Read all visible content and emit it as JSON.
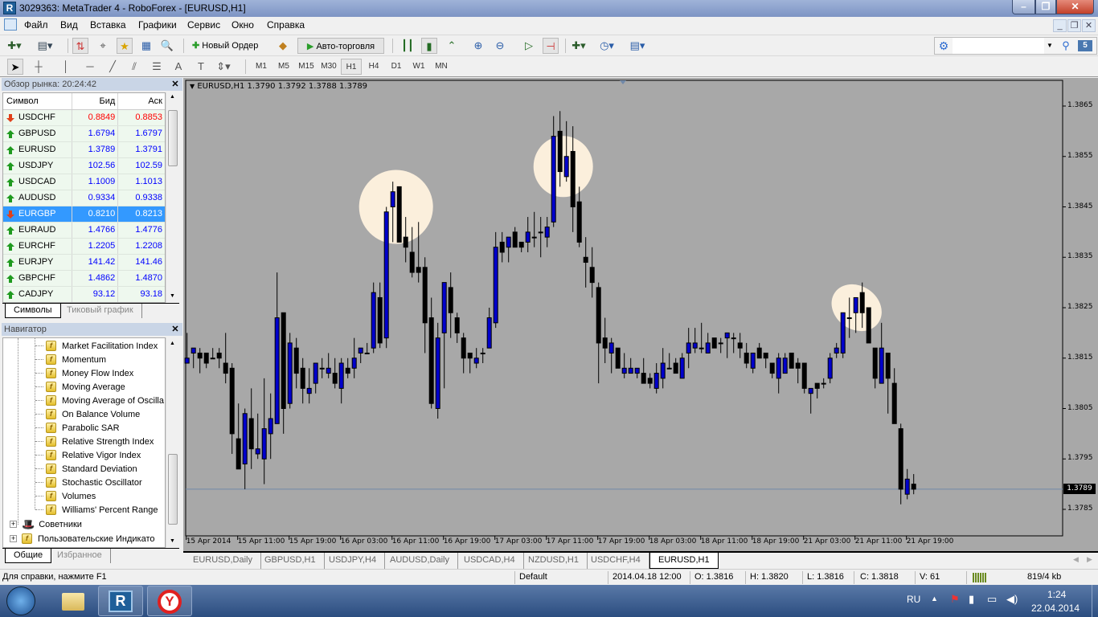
{
  "window": {
    "title": "3029363: MetaTrader 4 - RoboForex - [EURUSD,H1]",
    "logo_text": "R"
  },
  "menu": [
    "Файл",
    "Вид",
    "Вставка",
    "Графики",
    "Сервис",
    "Окно",
    "Справка"
  ],
  "toolbar": {
    "new_order": "Новый Ордер",
    "autotrading": "Авто-торговля",
    "timeframes": [
      "M1",
      "M5",
      "M15",
      "M30",
      "H1",
      "H4",
      "D1",
      "W1",
      "MN"
    ],
    "active_timeframe": "H1",
    "text_tool": "A",
    "search_value": "",
    "messages_count": "5"
  },
  "market_watch": {
    "title": "Обзор рынка: 20:24:42",
    "columns": [
      "Символ",
      "Бид",
      "Аск"
    ],
    "rows": [
      {
        "symbol": "USDCHF",
        "bid": "0.8849",
        "ask": "0.8853",
        "dir": "down",
        "color": "#ff0000"
      },
      {
        "symbol": "GBPUSD",
        "bid": "1.6794",
        "ask": "1.6797",
        "dir": "up",
        "color": "#0000ff"
      },
      {
        "symbol": "EURUSD",
        "bid": "1.3789",
        "ask": "1.3791",
        "dir": "up",
        "color": "#0000ff"
      },
      {
        "symbol": "USDJPY",
        "bid": "102.56",
        "ask": "102.59",
        "dir": "up",
        "color": "#0000ff"
      },
      {
        "symbol": "USDCAD",
        "bid": "1.1009",
        "ask": "1.1013",
        "dir": "up",
        "color": "#0000ff"
      },
      {
        "symbol": "AUDUSD",
        "bid": "0.9334",
        "ask": "0.9338",
        "dir": "up",
        "color": "#0000ff"
      },
      {
        "symbol": "EURGBP",
        "bid": "0.8210",
        "ask": "0.8213",
        "dir": "down",
        "color": "#ffffff",
        "selected": true
      },
      {
        "symbol": "EURAUD",
        "bid": "1.4766",
        "ask": "1.4776",
        "dir": "up",
        "color": "#0000ff"
      },
      {
        "symbol": "EURCHF",
        "bid": "1.2205",
        "ask": "1.2208",
        "dir": "up",
        "color": "#0000ff"
      },
      {
        "symbol": "EURJPY",
        "bid": "141.42",
        "ask": "141.46",
        "dir": "up",
        "color": "#0000ff"
      },
      {
        "symbol": "GBPCHF",
        "bid": "1.4862",
        "ask": "1.4870",
        "dir": "up",
        "color": "#0000ff"
      },
      {
        "symbol": "CADJPY",
        "bid": "93.12",
        "ask": "93.18",
        "dir": "up",
        "color": "#0000ff"
      }
    ],
    "tabs": [
      "Символы",
      "Тиковый график"
    ]
  },
  "navigator": {
    "title": "Навигатор",
    "indicators": [
      "Market Facilitation Index",
      "Momentum",
      "Money Flow Index",
      "Moving Average",
      "Moving Average of Oscilla",
      "On Balance Volume",
      "Parabolic SAR",
      "Relative Strength Index",
      "Relative Vigor Index",
      "Standard Deviation",
      "Stochastic Oscillator",
      "Volumes",
      "Williams' Percent Range"
    ],
    "folders": [
      "Советники",
      "Пользовательские Индикато"
    ],
    "tabs": [
      "Общие",
      "Избранное"
    ]
  },
  "chart_data": {
    "type": "candlestick",
    "title": "EURUSD,H1",
    "header_ohlc": "1.3790 1.3792 1.3788 1.3789",
    "current_price": "1.3789",
    "ylim": [
      1.3781,
      1.3871
    ],
    "y_ticks": [
      "1.3865",
      "1.3855",
      "1.3845",
      "1.3835",
      "1.3825",
      "1.3815",
      "1.3805",
      "1.3795",
      "1.3785"
    ],
    "x_ticks": [
      "15 Apr 2014",
      "15 Apr 11:00",
      "15 Apr 19:00",
      "16 Apr 03:00",
      "16 Apr 11:00",
      "16 Apr 19:00",
      "17 Apr 03:00",
      "17 Apr 11:00",
      "17 Apr 19:00",
      "18 Apr 03:00",
      "18 Apr 11:00",
      "18 Apr 19:00",
      "21 Apr 03:00",
      "21 Apr 11:00",
      "21 Apr 19:00"
    ],
    "x_tick_every_bars": 8,
    "bull_color": "#0000cc",
    "bear_color": "#000000",
    "background": "#a8a8a8",
    "highlight_color": "#fbefdc",
    "highlights_bar_index": [
      33,
      59,
      105
    ],
    "ohlc": [
      [
        1.3814,
        1.382,
        1.3814,
        1.3815
      ],
      [
        1.3816,
        1.3817,
        1.3813,
        1.3817
      ],
      [
        1.3816,
        1.3817,
        1.3812,
        1.3815
      ],
      [
        1.3816,
        1.3816,
        1.3813,
        1.3814
      ],
      [
        1.3815,
        1.3817,
        1.3815,
        1.3815
      ],
      [
        1.3816,
        1.3817,
        1.3813,
        1.3815
      ],
      [
        1.3814,
        1.382,
        1.381,
        1.3812
      ],
      [
        1.3813,
        1.3814,
        1.3796,
        1.38
      ],
      [
        1.3799,
        1.3806,
        1.3793,
        1.3793
      ],
      [
        1.3794,
        1.3805,
        1.3789,
        1.3804
      ],
      [
        1.3803,
        1.3809,
        1.3793,
        1.3797
      ],
      [
        1.3796,
        1.3804,
        1.3795,
        1.3797
      ],
      [
        1.3795,
        1.3811,
        1.379,
        1.3801
      ],
      [
        1.38,
        1.3808,
        1.3795,
        1.3803
      ],
      [
        1.3802,
        1.3832,
        1.3802,
        1.3823
      ],
      [
        1.3824,
        1.3824,
        1.38,
        1.3805
      ],
      [
        1.3806,
        1.382,
        1.3805,
        1.3818
      ],
      [
        1.3817,
        1.3819,
        1.3809,
        1.3812
      ],
      [
        1.3813,
        1.3815,
        1.3806,
        1.3809
      ],
      [
        1.3808,
        1.3813,
        1.3806,
        1.3809
      ],
      [
        1.381,
        1.3814,
        1.3808,
        1.3814
      ],
      [
        1.3813,
        1.3815,
        1.3811,
        1.3813
      ],
      [
        1.3812,
        1.3816,
        1.3811,
        1.3813
      ],
      [
        1.3812,
        1.3815,
        1.3809,
        1.381
      ],
      [
        1.3809,
        1.3815,
        1.3806,
        1.3814
      ],
      [
        1.3813,
        1.3815,
        1.3811,
        1.3812
      ],
      [
        1.3813,
        1.3819,
        1.3811,
        1.3815
      ],
      [
        1.3816,
        1.3817,
        1.3814,
        1.3817
      ],
      [
        1.3816,
        1.3818,
        1.3816,
        1.3816
      ],
      [
        1.3817,
        1.383,
        1.3816,
        1.3828
      ],
      [
        1.3827,
        1.383,
        1.3817,
        1.3818
      ],
      [
        1.3819,
        1.3845,
        1.3817,
        1.3844
      ],
      [
        1.3845,
        1.385,
        1.3838,
        1.3848
      ],
      [
        1.3849,
        1.3849,
        1.3838,
        1.3838
      ],
      [
        1.3839,
        1.3843,
        1.3834,
        1.3837
      ],
      [
        1.3836,
        1.3841,
        1.3831,
        1.3832
      ],
      [
        1.3833,
        1.3842,
        1.383,
        1.3832
      ],
      [
        1.3833,
        1.3835,
        1.3816,
        1.3822
      ],
      [
        1.3823,
        1.3827,
        1.3805,
        1.3806
      ],
      [
        1.3805,
        1.3822,
        1.3803,
        1.3819
      ],
      [
        1.382,
        1.383,
        1.3809,
        1.383
      ],
      [
        1.3829,
        1.3832,
        1.3819,
        1.3824
      ],
      [
        1.3823,
        1.3824,
        1.3818,
        1.382
      ],
      [
        1.3819,
        1.382,
        1.3812,
        1.3815
      ],
      [
        1.3816,
        1.3816,
        1.3812,
        1.3815
      ],
      [
        1.3814,
        1.3817,
        1.3813,
        1.3815
      ],
      [
        1.3816,
        1.3817,
        1.3814,
        1.3816
      ],
      [
        1.3817,
        1.3825,
        1.3817,
        1.3823
      ],
      [
        1.3822,
        1.384,
        1.3821,
        1.3837
      ],
      [
        1.3838,
        1.384,
        1.3834,
        1.3836
      ],
      [
        1.3837,
        1.3839,
        1.3834,
        1.3839
      ],
      [
        1.384,
        1.3841,
        1.3837,
        1.3837
      ],
      [
        1.3838,
        1.3838,
        1.3836,
        1.3837
      ],
      [
        1.3838,
        1.3843,
        1.3836,
        1.384
      ],
      [
        1.3839,
        1.3844,
        1.3837,
        1.3839
      ],
      [
        1.384,
        1.3843,
        1.3835,
        1.384
      ],
      [
        1.3839,
        1.3843,
        1.3837,
        1.3841
      ],
      [
        1.3842,
        1.3863,
        1.3841,
        1.3859
      ],
      [
        1.386,
        1.3864,
        1.3849,
        1.3852
      ],
      [
        1.3851,
        1.3862,
        1.385,
        1.3855
      ],
      [
        1.3856,
        1.3861,
        1.384,
        1.3845
      ],
      [
        1.3846,
        1.3849,
        1.3837,
        1.3838
      ],
      [
        1.3835,
        1.3839,
        1.3829,
        1.3834
      ],
      [
        1.3833,
        1.3837,
        1.3827,
        1.383
      ],
      [
        1.3829,
        1.383,
        1.381,
        1.3818
      ],
      [
        1.3819,
        1.3823,
        1.3814,
        1.3817
      ],
      [
        1.3816,
        1.3819,
        1.3812,
        1.3818
      ],
      [
        1.3817,
        1.3817,
        1.3813,
        1.3813
      ],
      [
        1.3812,
        1.3816,
        1.3811,
        1.3813
      ],
      [
        1.3812,
        1.3815,
        1.3812,
        1.3813
      ],
      [
        1.3812,
        1.3813,
        1.3811,
        1.3813
      ],
      [
        1.3812,
        1.3815,
        1.381,
        1.381
      ],
      [
        1.3811,
        1.3812,
        1.3809,
        1.381
      ],
      [
        1.3809,
        1.3814,
        1.3808,
        1.3812
      ],
      [
        1.3811,
        1.3817,
        1.3809,
        1.3814
      ],
      [
        1.3813,
        1.3816,
        1.3813,
        1.3813
      ],
      [
        1.3814,
        1.3815,
        1.3812,
        1.3812
      ],
      [
        1.3811,
        1.3816,
        1.3811,
        1.3815
      ],
      [
        1.3816,
        1.3821,
        1.3813,
        1.3818
      ],
      [
        1.3817,
        1.3821,
        1.3816,
        1.3818
      ],
      [
        1.3817,
        1.3822,
        1.3816,
        1.3817
      ],
      [
        1.3816,
        1.382,
        1.3816,
        1.3818
      ],
      [
        1.3819,
        1.3819,
        1.3817,
        1.3817
      ],
      [
        1.3818,
        1.3819,
        1.3816,
        1.3818
      ],
      [
        1.3819,
        1.382,
        1.3815,
        1.382
      ],
      [
        1.3819,
        1.382,
        1.3816,
        1.3819
      ],
      [
        1.3818,
        1.382,
        1.3815,
        1.3817
      ],
      [
        1.3816,
        1.3818,
        1.3813,
        1.3814
      ],
      [
        1.3813,
        1.3816,
        1.3812,
        1.3816
      ],
      [
        1.3817,
        1.3818,
        1.3815,
        1.3815
      ],
      [
        1.3816,
        1.3816,
        1.3813,
        1.3815
      ],
      [
        1.3814,
        1.3814,
        1.3811,
        1.3812
      ],
      [
        1.3811,
        1.3816,
        1.3808,
        1.3815
      ],
      [
        1.3812,
        1.3816,
        1.3812,
        1.3815
      ],
      [
        1.3816,
        1.3816,
        1.3813,
        1.3813
      ],
      [
        1.3814,
        1.3815,
        1.381,
        1.3813
      ],
      [
        1.3814,
        1.3814,
        1.3808,
        1.3809
      ],
      [
        1.3808,
        1.3809,
        1.3804,
        1.3809
      ],
      [
        1.381,
        1.381,
        1.3807,
        1.3809
      ],
      [
        1.381,
        1.3811,
        1.3809,
        1.381
      ],
      [
        1.3811,
        1.3816,
        1.381,
        1.3815
      ],
      [
        1.3816,
        1.3818,
        1.3815,
        1.3817
      ],
      [
        1.3816,
        1.3824,
        1.3815,
        1.3824
      ],
      [
        1.3823,
        1.3827,
        1.3819,
        1.3823
      ],
      [
        1.3824,
        1.3827,
        1.382,
        1.3827
      ],
      [
        1.3828,
        1.383,
        1.3821,
        1.3824
      ],
      [
        1.3825,
        1.3825,
        1.3818,
        1.3818
      ],
      [
        1.3817,
        1.3817,
        1.3809,
        1.3811
      ],
      [
        1.381,
        1.3822,
        1.381,
        1.3817
      ],
      [
        1.3816,
        1.3816,
        1.3804,
        1.3811
      ],
      [
        1.381,
        1.3813,
        1.3802,
        1.3802
      ],
      [
        1.3801,
        1.3802,
        1.3786,
        1.3789
      ],
      [
        1.3788,
        1.3793,
        1.3787,
        1.3791
      ],
      [
        1.379,
        1.3792,
        1.3788,
        1.3789
      ]
    ]
  },
  "chart_tabs": [
    "EURUSD,Daily",
    "GBPUSD,H1",
    "USDJPY,H4",
    "AUDUSD,Daily",
    "USDCAD,H4",
    "NZDUSD,H1",
    "USDCHF,H4",
    "EURUSD,H1"
  ],
  "status": {
    "help": "Для справки, нажмите F1",
    "profile": "Default",
    "datetime": "2014.04.18 12:00",
    "open": "O: 1.3816",
    "high": "H: 1.3820",
    "low": "L: 1.3816",
    "close": "C: 1.3818",
    "volume": "V: 61",
    "traffic": "819/4 kb"
  },
  "taskbar": {
    "lang": "RU",
    "time": "1:24",
    "date": "22.04.2014"
  }
}
